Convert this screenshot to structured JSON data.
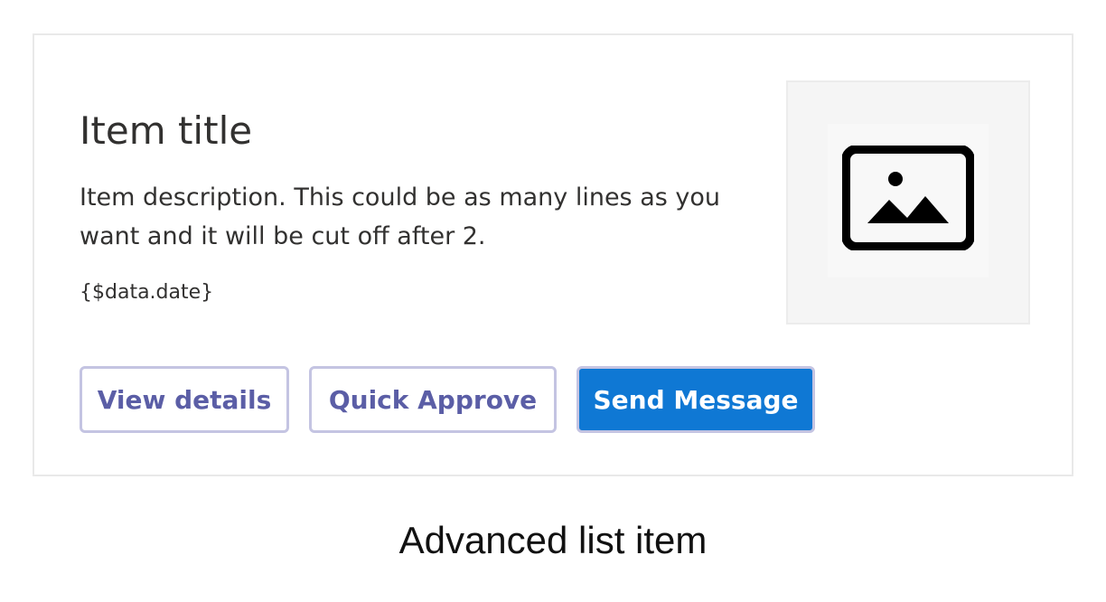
{
  "item": {
    "title": "Item title",
    "description": "Item description. This could be as many lines as you want and it will be cut off after 2.",
    "date": "{$data.date}"
  },
  "thumbnail": {
    "icon": "image-placeholder-icon"
  },
  "actions": {
    "view_details_label": "View details",
    "quick_approve_label": "Quick Approve",
    "send_message_label": "Send Message"
  },
  "caption": "Advanced list item",
  "colors": {
    "primary_button": "#0f78d4",
    "secondary_text": "#5b5ea6",
    "button_border": "#c4c4e2",
    "card_border": "#e9e9e9",
    "thumbnail_background": "#f5f5f5"
  }
}
